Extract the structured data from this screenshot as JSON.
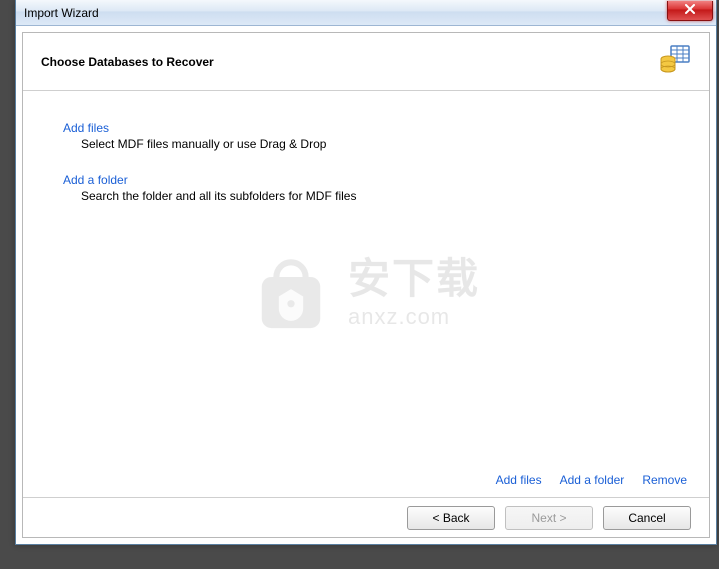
{
  "window": {
    "title": "Import Wizard"
  },
  "header": {
    "title": "Choose Databases to Recover"
  },
  "options": {
    "add_files": {
      "link": "Add files",
      "desc": "Select MDF files manually or use Drag & Drop"
    },
    "add_folder": {
      "link": "Add a folder",
      "desc": "Search the folder and all its subfolders for MDF files"
    }
  },
  "actions": {
    "add_files": "Add files",
    "add_folder": "Add a folder",
    "remove": "Remove"
  },
  "footer": {
    "back": "< Back",
    "next": "Next >",
    "cancel": "Cancel"
  },
  "watermark": {
    "cn": "安下载",
    "url": "anxz.com"
  }
}
